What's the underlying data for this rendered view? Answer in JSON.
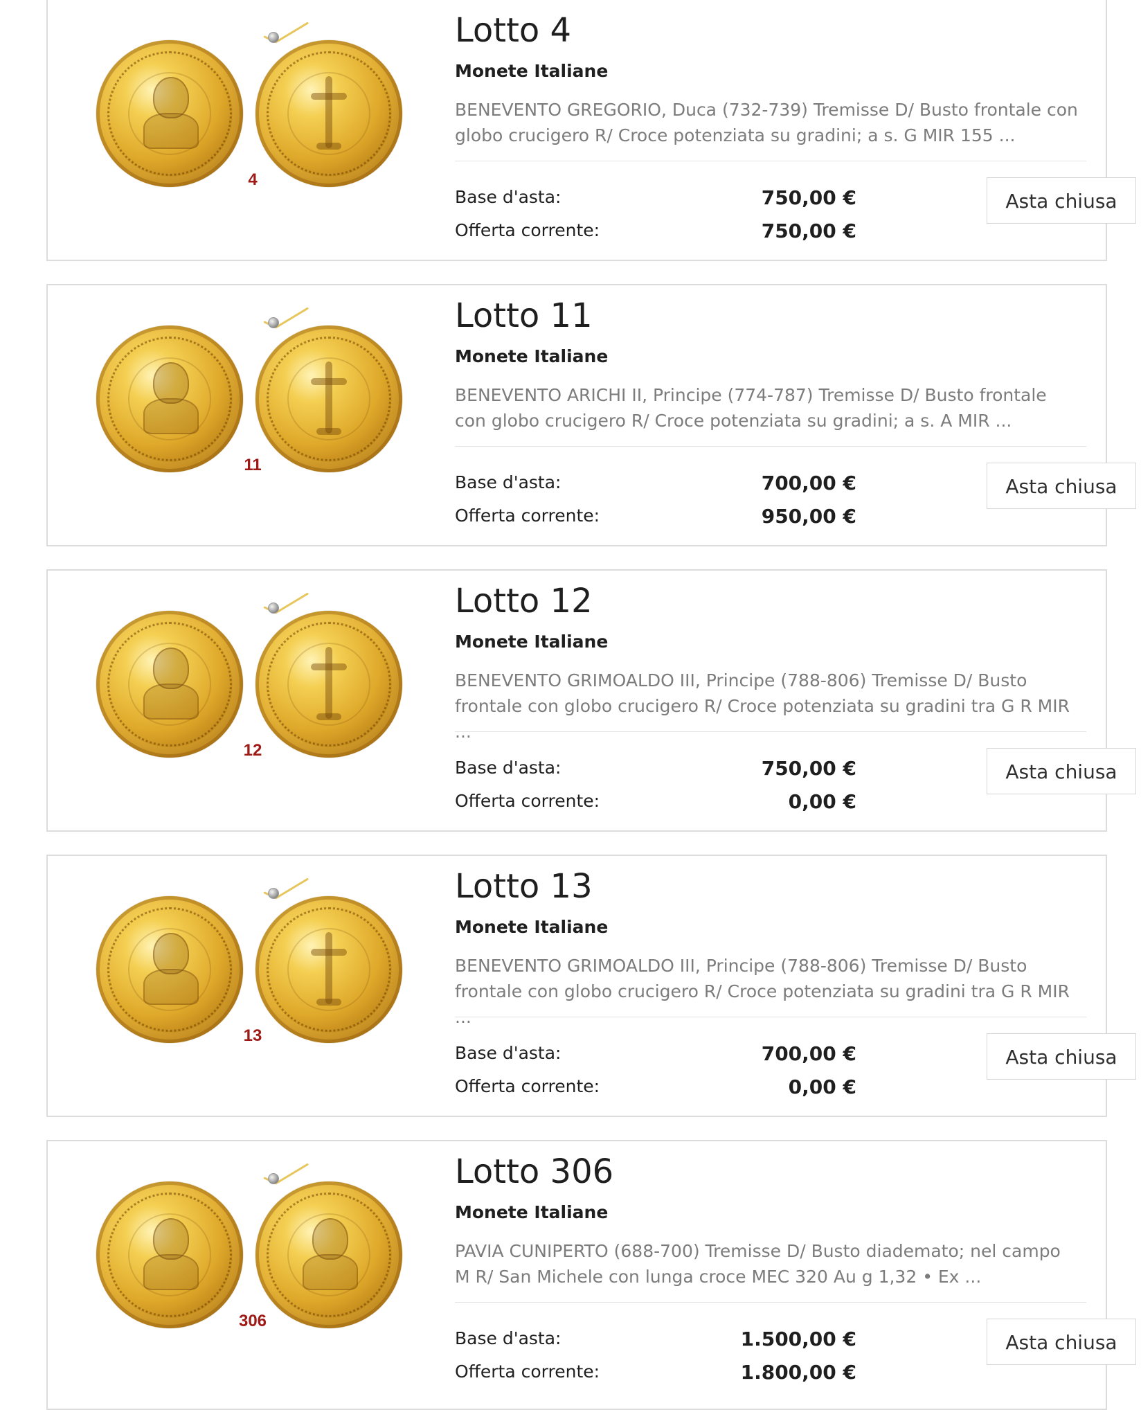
{
  "lots": [
    {
      "title": "Lotto 4",
      "category": "Monete Italiane",
      "description": "BENEVENTO GREGORIO, Duca (732-739) Tremisse D/ Busto frontale con globo crucigero R/ Croce potenziata su gradini; a s. G MIR 155 ...",
      "base_label": "Base d'asta:",
      "base_value": "750,00 €",
      "offer_label": "Offerta corrente:",
      "offer_value": "750,00 €",
      "status_label": "Asta chiusa",
      "coin_number": "4"
    },
    {
      "title": "Lotto 11",
      "category": "Monete Italiane",
      "description": "BENEVENTO ARICHI II, Principe (774-787) Tremisse D/ Busto frontale con globo crucigero R/ Croce potenziata su gradini; a s. A MIR ...",
      "base_label": "Base d'asta:",
      "base_value": "700,00 €",
      "offer_label": "Offerta corrente:",
      "offer_value": "950,00 €",
      "status_label": "Asta chiusa",
      "coin_number": "11"
    },
    {
      "title": "Lotto 12",
      "category": "Monete Italiane",
      "description": "BENEVENTO GRIMOALDO III, Principe (788-806) Tremisse D/ Busto frontale con globo crucigero R/ Croce potenziata su gradini tra G R MIR ...",
      "base_label": "Base d'asta:",
      "base_value": "750,00 €",
      "offer_label": "Offerta corrente:",
      "offer_value": "0,00 €",
      "status_label": "Asta chiusa",
      "coin_number": "12"
    },
    {
      "title": "Lotto 13",
      "category": "Monete Italiane",
      "description": "BENEVENTO GRIMOALDO III, Principe (788-806) Tremisse D/ Busto frontale con globo crucigero R/ Croce potenziata su gradini tra G R MIR ...",
      "base_label": "Base d'asta:",
      "base_value": "700,00 €",
      "offer_label": "Offerta corrente:",
      "offer_value": "0,00 €",
      "status_label": "Asta chiusa",
      "coin_number": "13"
    },
    {
      "title": "Lotto 306",
      "category": "Monete Italiane",
      "description": "PAVIA CUNIPERTO (688-700) Tremisse D/ Busto diademato; nel campo M R/ San Michele con lunga croce MEC 320 Au g 1,32 • Ex ...",
      "base_label": "Base d'asta:",
      "base_value": "1.500,00 €",
      "offer_label": "Offerta corrente:",
      "offer_value": "1.800,00 €",
      "status_label": "Asta chiusa",
      "coin_number": "306"
    }
  ]
}
